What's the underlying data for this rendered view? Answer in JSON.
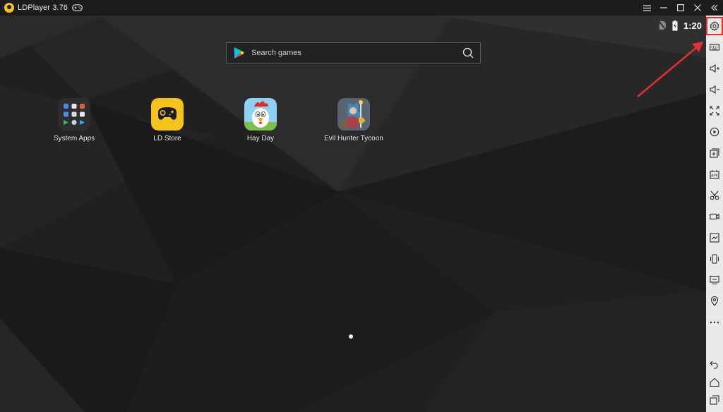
{
  "window": {
    "title": "LDPlayer 3.76",
    "title_icons": [
      "ldplayer-logo-icon",
      "gamepad-icon"
    ],
    "controls": [
      "menu-icon",
      "minimize-icon",
      "maximize-icon",
      "close-icon",
      "collapse-sidebar-icon"
    ]
  },
  "status_bar": {
    "time": "1:20",
    "icons": [
      "no-sim-icon",
      "battery-charging-icon"
    ]
  },
  "search": {
    "placeholder": "Search games",
    "icons": [
      "google-play-icon",
      "search-icon"
    ]
  },
  "apps": [
    {
      "label": "System Apps",
      "icon": "system-apps-folder-icon"
    },
    {
      "label": "LD Store",
      "icon": "ld-store-icon"
    },
    {
      "label": "Hay Day",
      "icon": "hay-day-icon"
    },
    {
      "label": "Evil Hunter Tycoon",
      "icon": "evil-hunter-tycoon-icon"
    }
  ],
  "page_indicator": {
    "pages": 1,
    "current": 1
  },
  "toolbar": {
    "items": [
      "settings-icon",
      "keyboard-mapping-icon",
      "volume-up-icon",
      "volume-down-icon",
      "fullscreen-icon",
      "operation-record-icon",
      "multi-instance-icon",
      "install-apk-icon",
      "screenshot-icon",
      "record-video-icon",
      "shared-folder-icon",
      "shake-icon",
      "virtual-screen-icon",
      "location-icon",
      "more-icon",
      "back-icon",
      "home-icon",
      "recent-apps-icon"
    ],
    "highlighted": "settings-icon"
  },
  "colors": {
    "titlebar": "#1c1c1c",
    "toolbar": "#e9e9e9",
    "highlight": "#e5322e",
    "ld_yellow": "#f6c21c"
  }
}
